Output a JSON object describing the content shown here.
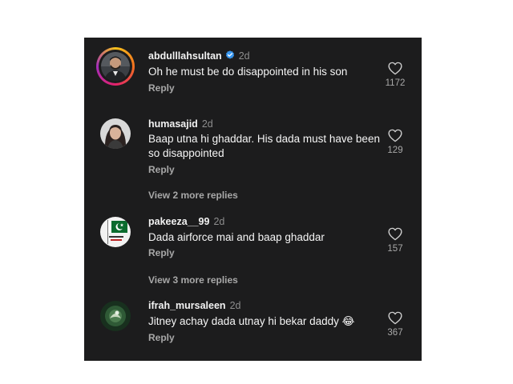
{
  "comments": [
    {
      "username": "abdulllahsultan",
      "verified": true,
      "time": "2d",
      "text": "Oh he must be do disappointed in his son",
      "reply_label": "Reply",
      "likes": "1172",
      "avatar_icon": "portrait-man-icon"
    },
    {
      "username": "humasajid",
      "verified": false,
      "time": "2d",
      "text": "Baap utna hi ghaddar. His dada must have been so disappointed",
      "reply_label": "Reply",
      "likes": "129",
      "view_more": "View 2 more replies",
      "avatar_icon": "portrait-woman-icon"
    },
    {
      "username": "pakeeza__99",
      "verified": false,
      "time": "2d",
      "text": "Dada airforce mai and baap ghaddar",
      "reply_label": "Reply",
      "likes": "157",
      "view_more": "View 3 more replies",
      "avatar_icon": "pakistan-flag-icon"
    },
    {
      "username": "ifrah_mursaleen",
      "verified": false,
      "time": "2d",
      "text": "Jitney achay dada utnay hi bekar daddy 😂",
      "reply_label": "Reply",
      "likes": "367",
      "avatar_icon": "green-emblem-icon"
    }
  ],
  "colors": {
    "background": "#1c1c1d",
    "text_primary": "#f5f5f5",
    "text_secondary": "#a8a8a8",
    "verified_blue": "#3897f0"
  }
}
